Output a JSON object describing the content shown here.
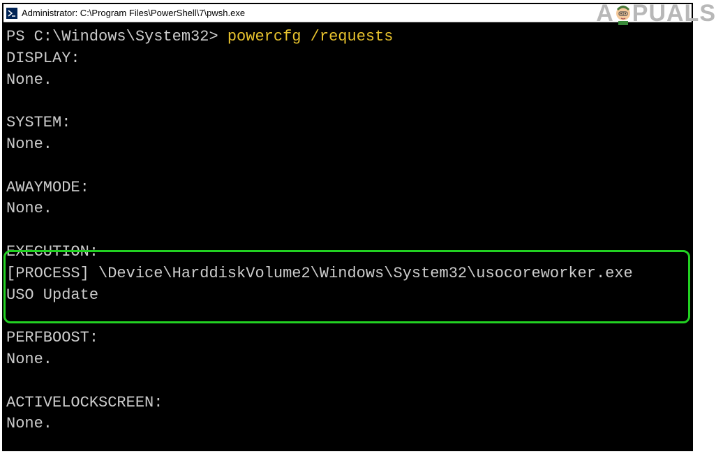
{
  "window": {
    "title": "Administrator: C:\\Program Files\\PowerShell\\7\\pwsh.exe"
  },
  "prompt": {
    "path": "PS C:\\Windows\\System32> ",
    "command": "powercfg /requests"
  },
  "output": {
    "display_header": "DISPLAY:",
    "display_value": "None.",
    "system_header": "SYSTEM:",
    "system_value": "None.",
    "awaymode_header": "AWAYMODE:",
    "awaymode_value": "None.",
    "execution_header": "EXECUTION:",
    "execution_process": "[PROCESS] \\Device\\HarddiskVolume2\\Windows\\System32\\usocoreworker.exe",
    "execution_reason": "USO Update",
    "perfboost_header": "PERFBOOST:",
    "perfboost_value": "None.",
    "activelockscreen_header": "ACTIVELOCKSCREEN:",
    "activelockscreen_value": "None."
  },
  "watermark": {
    "prefix": "A",
    "suffix": "PUALS"
  }
}
